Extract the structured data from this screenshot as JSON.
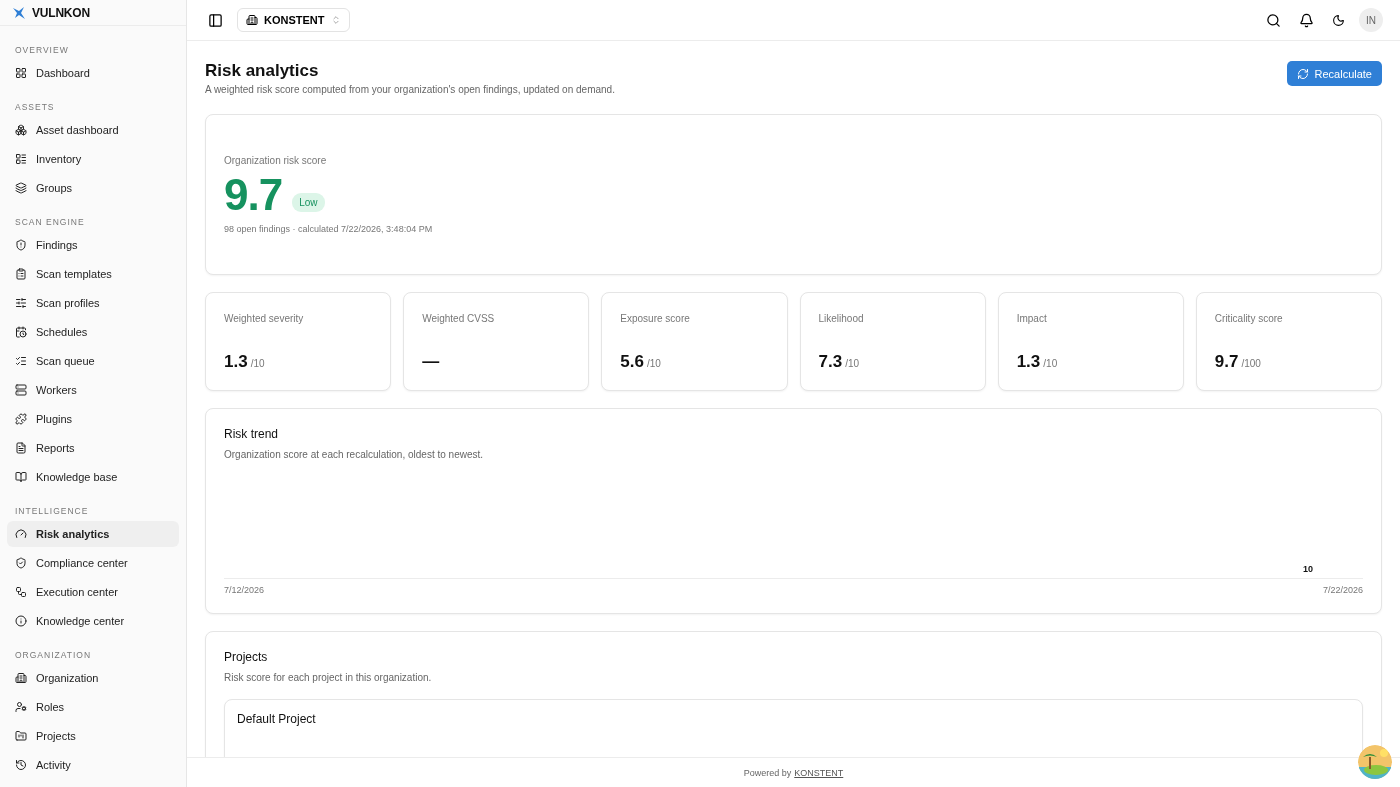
{
  "brand": "VULNKON",
  "sidebar": {
    "sections": [
      {
        "title": "OVERVIEW",
        "items": [
          {
            "label": "Dashboard",
            "selected": false
          }
        ]
      },
      {
        "title": "ASSETS",
        "items": [
          {
            "label": "Asset dashboard",
            "selected": false
          },
          {
            "label": "Inventory",
            "selected": false
          },
          {
            "label": "Groups",
            "selected": false
          }
        ]
      },
      {
        "title": "SCAN ENGINE",
        "items": [
          {
            "label": "Findings",
            "selected": false
          },
          {
            "label": "Scan templates",
            "selected": false
          },
          {
            "label": "Scan profiles",
            "selected": false
          },
          {
            "label": "Schedules",
            "selected": false
          },
          {
            "label": "Scan queue",
            "selected": false
          },
          {
            "label": "Workers",
            "selected": false
          },
          {
            "label": "Plugins",
            "selected": false
          },
          {
            "label": "Reports",
            "selected": false
          },
          {
            "label": "Knowledge base",
            "selected": false
          }
        ]
      },
      {
        "title": "INTELLIGENCE",
        "items": [
          {
            "label": "Risk analytics",
            "selected": true
          },
          {
            "label": "Compliance center",
            "selected": false
          },
          {
            "label": "Execution center",
            "selected": false
          },
          {
            "label": "Knowledge center",
            "selected": false
          }
        ]
      },
      {
        "title": "ORGANIZATION",
        "items": [
          {
            "label": "Organization",
            "selected": false
          },
          {
            "label": "Roles",
            "selected": false
          },
          {
            "label": "Projects",
            "selected": false
          },
          {
            "label": "Activity",
            "selected": false
          }
        ]
      }
    ]
  },
  "topbar": {
    "org": "KONSTENT",
    "avatar": "IN"
  },
  "page": {
    "title": "Risk analytics",
    "subtitle": "A weighted risk score computed from your organization's open findings, updated on demand.",
    "button": "Recalculate"
  },
  "score": {
    "label": "Organization risk score",
    "value": "9.7",
    "badge": "Low",
    "meta": "98 open findings · calculated 7/22/2026, 3:48:04 PM"
  },
  "metrics": [
    {
      "label": "Weighted severity",
      "value": "1.3",
      "unit": "/10"
    },
    {
      "label": "Weighted CVSS",
      "value": "—"
    },
    {
      "label": "Exposure score",
      "value": "5.6",
      "unit": "/10"
    },
    {
      "label": "Likelihood",
      "value": "7.3",
      "unit": "/10"
    },
    {
      "label": "Impact",
      "value": "1.3",
      "unit": "/10"
    },
    {
      "label": "Criticality score",
      "value": "9.7",
      "unit": "/100"
    }
  ],
  "trend": {
    "title": "Risk trend",
    "subtitle": "Organization score at each recalculation, oldest to newest.",
    "point_label": "10",
    "start_date": "7/12/2026",
    "end_date": "7/22/2026"
  },
  "projects": {
    "title": "Projects",
    "subtitle": "Risk score for each project in this organization.",
    "items": [
      {
        "name": "Default Project"
      }
    ]
  },
  "footer": {
    "text": "Powered by",
    "link": "KONSTENT"
  }
}
